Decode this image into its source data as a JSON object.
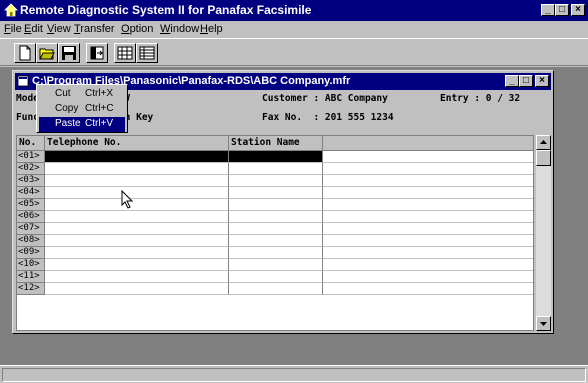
{
  "window": {
    "title": "Remote Diagnostic System II for Panafax Facsimile"
  },
  "menu": [
    {
      "label": "File",
      "ul": "F",
      "rest": "ile"
    },
    {
      "label": "Edit",
      "ul": "E",
      "rest": "dit"
    },
    {
      "label": "View",
      "ul": "V",
      "rest": "iew"
    },
    {
      "label": "Transfer",
      "ul": "T",
      "rest": "ransfer"
    },
    {
      "label": "Option",
      "ul": "O",
      "rest": "ption"
    },
    {
      "label": "Window",
      "ul": "W",
      "rest": "indow"
    },
    {
      "label": "Help",
      "ul": "H",
      "rest": "elp"
    }
  ],
  "toolbar": {
    "buttons": [
      "new-document-icon",
      "open-folder-icon",
      "save-disk-icon",
      "transfer-icon",
      "grid-view-icon",
      "list-view-icon"
    ]
  },
  "document": {
    "title": "C:\\Program Files\\Panasonic\\Panafax-RDS\\ABC Company.mfr",
    "model_label": "Model    : UF-895-UV",
    "customer_label": "Customer : ABC Company",
    "entry_label": "Entry : 0 / 32",
    "function_label": "Function : One-Touch Key",
    "fax_label": "Fax No.  : 201 555 1234"
  },
  "grid": {
    "headers": [
      "No.",
      "Telephone No.",
      "Station Name"
    ],
    "rows": [
      "<01>",
      "<02>",
      "<03>",
      "<04>",
      "<05>",
      "<06>",
      "<07>",
      "<08>",
      "<09>",
      "<10>",
      "<11>",
      "<12>"
    ],
    "selected_row": "<01>"
  },
  "context_menu": {
    "items": [
      {
        "label": "Cut",
        "shortcut": "Ctrl+X"
      },
      {
        "label": "Copy",
        "shortcut": "Ctrl+C"
      },
      {
        "label": "Paste",
        "shortcut": "Ctrl+V"
      }
    ],
    "highlighted": "Paste"
  },
  "colors": {
    "title_bar": "#000080",
    "face": "#c0c0c0",
    "mdi_background": "#808080",
    "highlight": "#000080"
  }
}
